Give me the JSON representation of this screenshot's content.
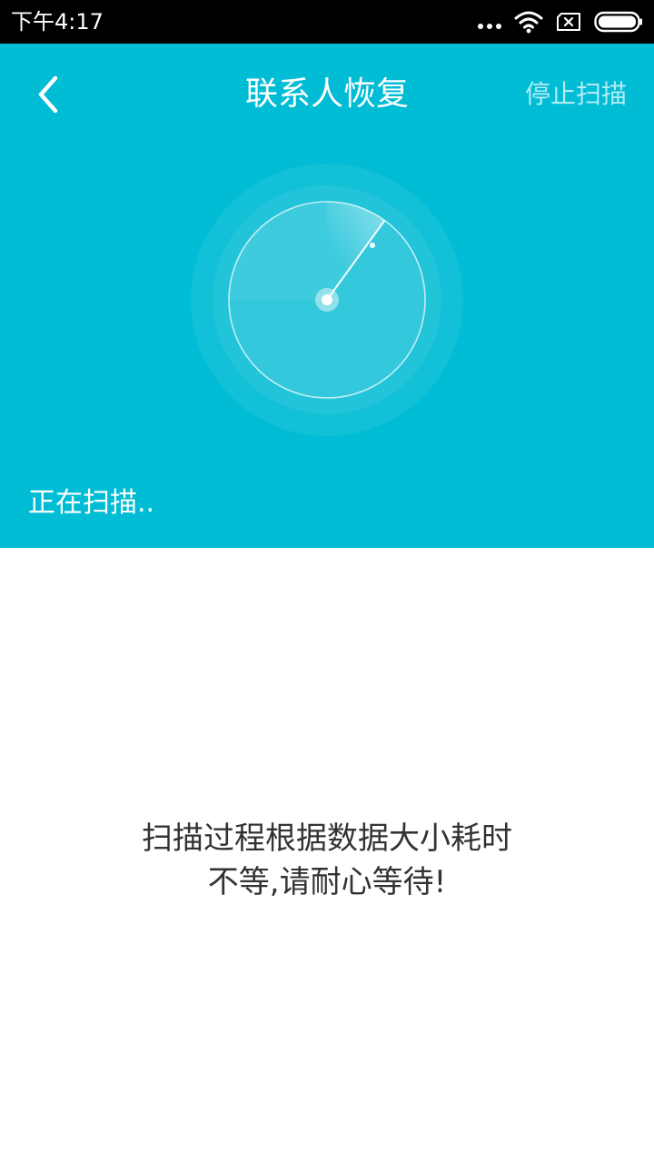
{
  "status_bar": {
    "time": "下午4:17",
    "icons": [
      "more-dots-icon",
      "wifi-icon",
      "sim-card-icon",
      "battery-icon"
    ]
  },
  "header": {
    "title": "联系人恢复",
    "stop_label": "停止扫描",
    "scan_status": "正在扫描..",
    "background_color": "#00bcd4"
  },
  "body": {
    "message_line1": "扫描过程根据数据大小耗时",
    "message_line2": "不等,请耐心等待!"
  }
}
